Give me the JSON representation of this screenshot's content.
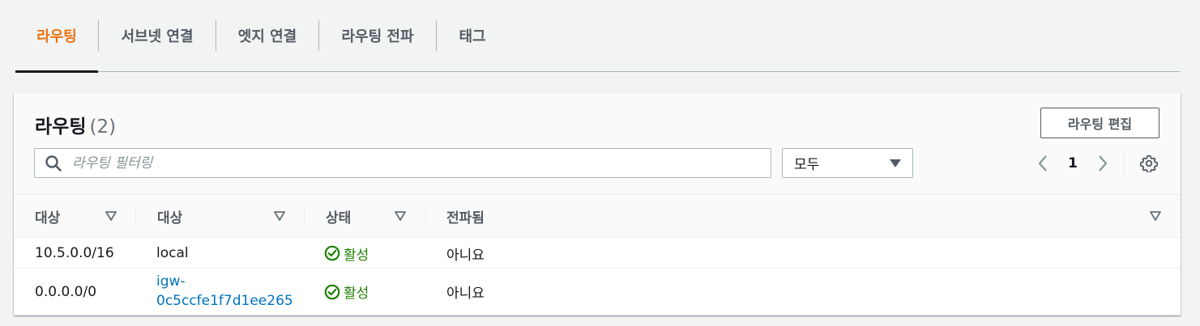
{
  "tabs": [
    {
      "label": "라우팅",
      "active": true
    },
    {
      "label": "서브넷 연결",
      "active": false
    },
    {
      "label": "엣지 연결",
      "active": false
    },
    {
      "label": "라우팅 전파",
      "active": false
    },
    {
      "label": "태그",
      "active": false
    }
  ],
  "panel": {
    "title": "라우팅",
    "count": "(2)",
    "edit_button": "라우팅 편집"
  },
  "filter": {
    "placeholder": "라우팅 필터링",
    "value": ""
  },
  "select": {
    "value": "모두"
  },
  "pagination": {
    "current_page": "1"
  },
  "table": {
    "columns": [
      "대상",
      "대상",
      "상태",
      "전파됨"
    ],
    "rows": [
      {
        "destination": "10.5.0.0/16",
        "target": "local",
        "target_is_link": false,
        "status": "활성",
        "propagated": "아니요"
      },
      {
        "destination": "0.0.0.0/0",
        "target_line1": "igw-",
        "target_line2": "0c5ccfe1f7d1ee265",
        "target_is_link": true,
        "status": "활성",
        "propagated": "아니요"
      }
    ]
  },
  "colors": {
    "accent": "#ec7211",
    "link": "#0073bb",
    "status_active": "#1d8102"
  },
  "icons": [
    "search-icon",
    "chevron-down-icon",
    "chevron-left-icon",
    "chevron-right-icon",
    "gear-icon",
    "sort-icon",
    "check-circle-icon"
  ]
}
